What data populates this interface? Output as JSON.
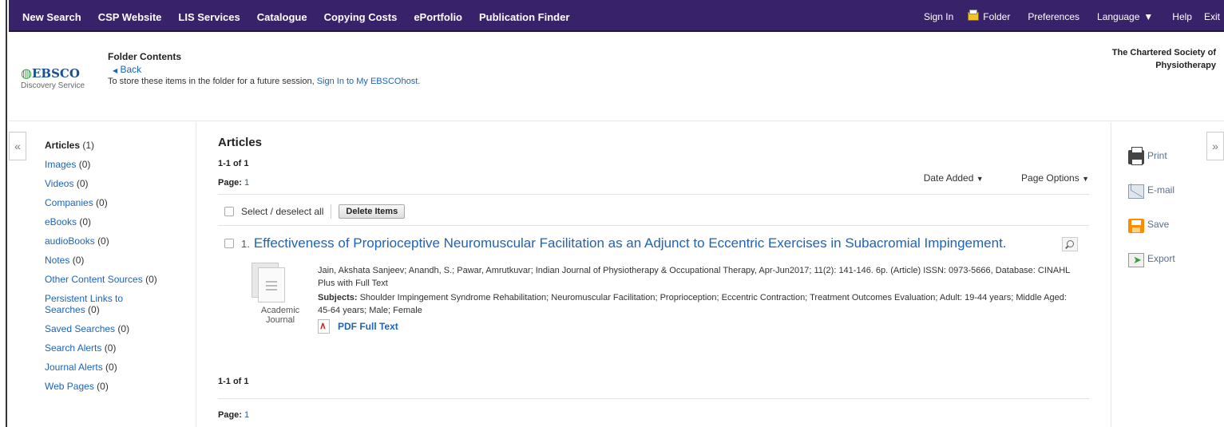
{
  "topnav": {
    "left": [
      "New Search",
      "CSP Website",
      "LIS Services",
      "Catalogue",
      "Copying Costs",
      "ePortfolio",
      "Publication Finder"
    ],
    "sign_in": "Sign In",
    "folder": "Folder",
    "preferences": "Preferences",
    "language": "Language",
    "help": "Help",
    "exit": "Exit"
  },
  "header": {
    "logo_brand": "EBSCO",
    "logo_sub": "Discovery Service",
    "folder_title": "Folder Contents",
    "back": "Back",
    "store_text": "To store these items in the folder for a future session,",
    "store_link": "Sign In to My EBSCOhost.",
    "org_line1": "The Chartered Society of",
    "org_line2": "Physiotherapy"
  },
  "sidebar": {
    "items": [
      {
        "label": "Articles",
        "count": "(1)"
      },
      {
        "label": "Images",
        "count": "(0)"
      },
      {
        "label": "Videos",
        "count": "(0)"
      },
      {
        "label": "Companies",
        "count": "(0)"
      },
      {
        "label": "eBooks",
        "count": "(0)"
      },
      {
        "label": "audioBooks",
        "count": "(0)"
      },
      {
        "label": "Notes",
        "count": "(0)"
      },
      {
        "label": "Other Content Sources",
        "count": "(0)"
      },
      {
        "label": "Persistent Links to Searches",
        "count": "(0)"
      },
      {
        "label": "Saved Searches",
        "count": "(0)"
      },
      {
        "label": "Search Alerts",
        "count": "(0)"
      },
      {
        "label": "Journal Alerts",
        "count": "(0)"
      },
      {
        "label": "Web Pages",
        "count": "(0)"
      }
    ]
  },
  "main": {
    "heading": "Articles",
    "range": "1-1 of 1",
    "page_label": "Page:",
    "page_num": "1",
    "date_added": "Date Added",
    "page_options": "Page Options",
    "select_all": "Select / deselect all",
    "delete_items": "Delete Items",
    "result": {
      "num": "1.",
      "title": "Effectiveness of Proprioceptive Neuromuscular Facilitation as an Adjunct to Eccentric Exercises in Subacromial Impingement.",
      "meta": "Jain, Akshata Sanjeev; Anandh, S.; Pawar, Amrutkuvar; Indian Journal of Physiotherapy & Occupational Therapy, Apr-Jun2017; 11(2): 141-146. 6p. (Article) ISSN: 0973-5666, Database: CINAHL Plus with Full Text",
      "subjects_label": "Subjects:",
      "subjects": "Shoulder Impingement Syndrome Rehabilitation; Neuromuscular Facilitation; Proprioception; Eccentric Contraction; Treatment Outcomes Evaluation; Adult: 19-44 years; Middle Aged: 45-64 years; Male; Female",
      "doc_type": "Academic Journal",
      "pdf": "PDF Full Text"
    },
    "range_bottom": "1-1 of 1",
    "page_label_bottom": "Page:",
    "page_num_bottom": "1"
  },
  "tools": {
    "print": "Print",
    "email": "E-mail",
    "save": "Save",
    "export": "Export"
  }
}
